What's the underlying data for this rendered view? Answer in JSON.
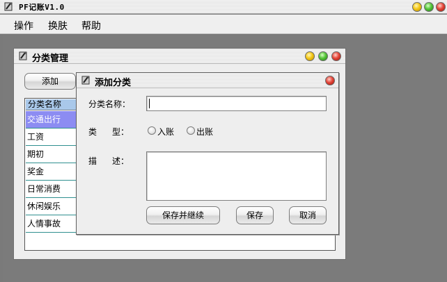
{
  "app": {
    "title": "PF记账V1.0",
    "menu": [
      "操作",
      "换肤",
      "帮助"
    ]
  },
  "category_window": {
    "title": "分类管理",
    "add_button": "添加",
    "list": {
      "header": "分类名称",
      "items": [
        "交通出行",
        "工资",
        "期初",
        "奖金",
        "日常消费",
        "休闲娱乐",
        "人情事故"
      ],
      "selected_index": 0
    }
  },
  "add_dialog": {
    "title": "添加分类",
    "name_label": "分类名称：",
    "name_value": "",
    "type_label_left": "类",
    "type_label_right": "型：",
    "type_options": [
      "入账",
      "出账"
    ],
    "desc_label_left": "描",
    "desc_label_right": "述：",
    "desc_value": "",
    "buttons": {
      "save_continue": "保存并继续",
      "save": "保存",
      "cancel": "取消"
    }
  },
  "colors": {
    "selected_row": "#8c8cf2",
    "list_header": "#a9c8ea",
    "desktop": "#7b7b7b"
  }
}
